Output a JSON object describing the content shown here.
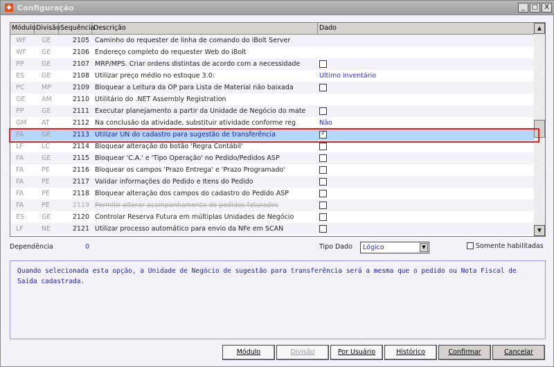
{
  "window": {
    "title": "Configuração",
    "min": "_",
    "max": "□",
    "close": "X"
  },
  "grid": {
    "headers": [
      "Módulo",
      "Divisão",
      "Sequência",
      "Descrição",
      "Dado"
    ],
    "rows": [
      {
        "mod": "WF",
        "div": "GE",
        "seq": "2105",
        "desc": "Caminho do requester de linha de comando do iBolt Server",
        "dado": ""
      },
      {
        "mod": "WF",
        "div": "GE",
        "seq": "2106",
        "desc": "Endereço completo do requester Web do iBolt",
        "dado": ""
      },
      {
        "mod": "PP",
        "div": "GE",
        "seq": "2107",
        "desc": "MRP/MPS. Criar ordens distintas de acordo com a necessidade",
        "check": false
      },
      {
        "mod": "ES",
        "div": "GE",
        "seq": "2108",
        "desc": "Utilizar preço médio no estoque 3.0:",
        "dado": "Ultimo inventário"
      },
      {
        "mod": "PC",
        "div": "MP",
        "seq": "2109",
        "desc": "Bloquear a Leitura da OP para Lista de Material não baixada",
        "check": false
      },
      {
        "mod": "GE",
        "div": "AM",
        "seq": "2110",
        "desc": "Utilitário do .NET Assembly Registration",
        "dado": ""
      },
      {
        "mod": "PP",
        "div": "GE",
        "seq": "2111",
        "desc": "Executar planejamento a partir da Unidade de Negócio do mate",
        "check": false
      },
      {
        "mod": "GM",
        "div": "AT",
        "seq": "2112",
        "desc": "Na conclusão da atividade, substituir atividade conforme reg",
        "dado": "Não"
      },
      {
        "mod": "FA",
        "div": "GE",
        "seq": "2113",
        "desc": "Utilizar UN do cadastro para sugestão de transferência",
        "check": true,
        "selected": true
      },
      {
        "mod": "LF",
        "div": "LC",
        "seq": "2114",
        "desc": "Bloquear alteração do botão 'Regra Contábil'",
        "check": false
      },
      {
        "mod": "FA",
        "div": "GE",
        "seq": "2115",
        "desc": "Bloquear 'C.A.' e 'Tipo Operação' no Pedido/Pedidos ASP",
        "check": false
      },
      {
        "mod": "FA",
        "div": "PE",
        "seq": "2116",
        "desc": "Bloquear os campos 'Prazo Entrega' e 'Prazo Programado'",
        "check": false
      },
      {
        "mod": "FA",
        "div": "PE",
        "seq": "2117",
        "desc": "Validar informações do Pedido e Itens do Pedido",
        "check": false
      },
      {
        "mod": "FA",
        "div": "PE",
        "seq": "2118",
        "desc": "Bloquear alteração dos campos do cadastro do Pedido ASP",
        "check": false
      },
      {
        "mod": "FA",
        "div": "PE",
        "seq": "2119",
        "desc": "Permitir alterar acompanhamento de pedidos faturados",
        "check": false,
        "disabled": true
      },
      {
        "mod": "ES",
        "div": "GE",
        "seq": "2120",
        "desc": "Controlar Reserva Futura em múltiplas Unidades de Negócio",
        "check": false
      },
      {
        "mod": "LF",
        "div": "NE",
        "seq": "2121",
        "desc": "Utilizar processo automático para envio da NFe em SCAN",
        "check": false
      }
    ]
  },
  "footer": {
    "dependencia_label": "Dependência",
    "dependencia_value": "0",
    "tipo_dado_label": "Tipo Dado",
    "tipo_dado_value": "Lógico",
    "somente_label": "Somente habilitadas"
  },
  "description": "Quando selecionada esta opção, a Unidade de Negócio de sugestão para transferência será a mesma que o pedido ou Nota Fiscal de Saída cadastrada.",
  "buttons": {
    "modulo": "Módulo",
    "divisao": "Divisão",
    "por_usuario": "Por Usuário",
    "historico": "Histórico",
    "confirmar": "Confirmar",
    "cancelar": "Cancelar"
  }
}
